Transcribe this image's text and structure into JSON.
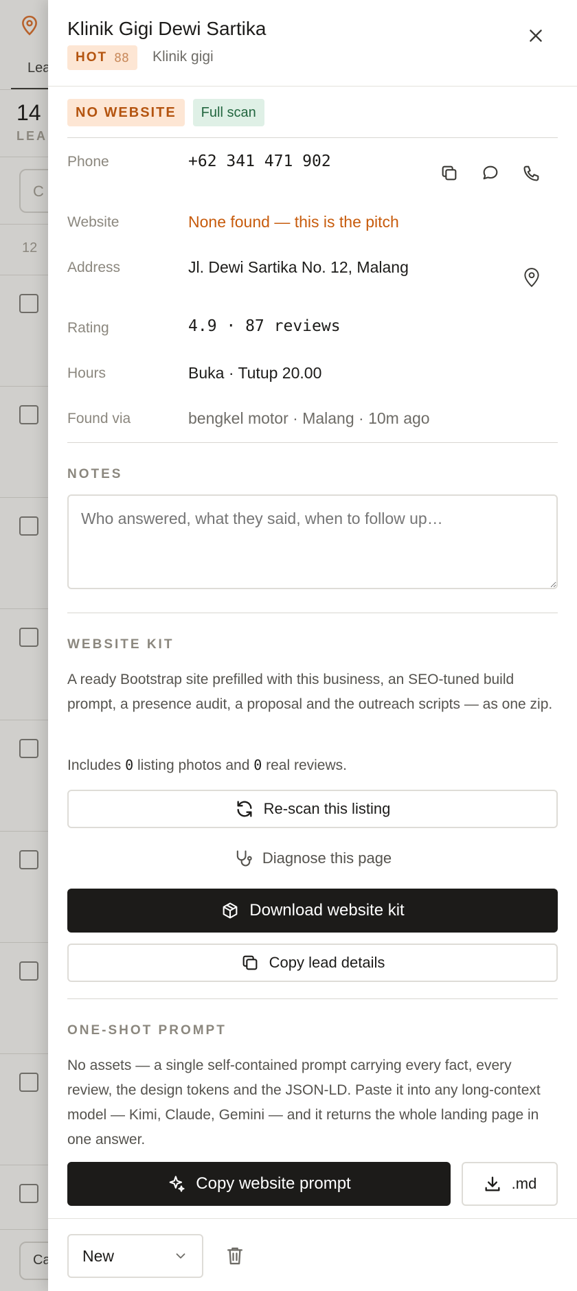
{
  "background": {
    "tab_partial": "Lea",
    "count_partial": "14",
    "label_partial": "LEA",
    "rows_partial": "12",
    "button_partial": "Ca"
  },
  "lead": {
    "name": "Klinik Gigi Dewi Sartika",
    "badge_label": "HOT",
    "score": "88",
    "category": "Klinik gigi",
    "tags": [
      "NO WEBSITE",
      "Full scan"
    ]
  },
  "details": {
    "phone_label": "Phone",
    "phone": "+62 341 471 902",
    "website_label": "Website",
    "website": "None found — this is the pitch",
    "address_label": "Address",
    "address": "Jl. Dewi Sartika No. 12, Malang",
    "rating_label": "Rating",
    "rating": "4.9 · 87 reviews",
    "hours_label": "Hours",
    "hours": "Buka · Tutup 20.00",
    "found_label": "Found via",
    "found": "bengkel motor · Malang · 10m ago"
  },
  "notes": {
    "title": "NOTES",
    "placeholder": "Who answered, what they said, when to follow up…"
  },
  "kit": {
    "title": "WEBSITE KIT",
    "description": "A ready Bootstrap site prefilled with this business, an SEO-tuned build prompt, a presence audit, a proposal and the outreach scripts — as one zip.",
    "includes_prefix": "Includes ",
    "photos_count": "0",
    "includes_mid": " listing photos and ",
    "reviews_count": "0",
    "includes_suffix": " real reviews.",
    "rescan_label": "Re-scan this listing",
    "diagnose_label": "Diagnose this page",
    "download_label": "Download website kit",
    "copy_details_label": "Copy lead details"
  },
  "oneshot": {
    "title": "ONE-SHOT PROMPT",
    "description": "No assets — a single self-contained prompt carrying every fact, every review, the design tokens and the JSON-LD. Paste it into any long-context model — Kimi, Claude, Gemini — and it returns the whole landing page in one answer.",
    "copy_prompt_label": "Copy website prompt",
    "md_label": ".md"
  },
  "footer": {
    "status_selected": "New"
  },
  "colors": {
    "accent_orange": "#c75b0c",
    "hot_bg": "#fde6d4",
    "scan_bg": "#dff0e6",
    "dark": "#1c1b19"
  }
}
